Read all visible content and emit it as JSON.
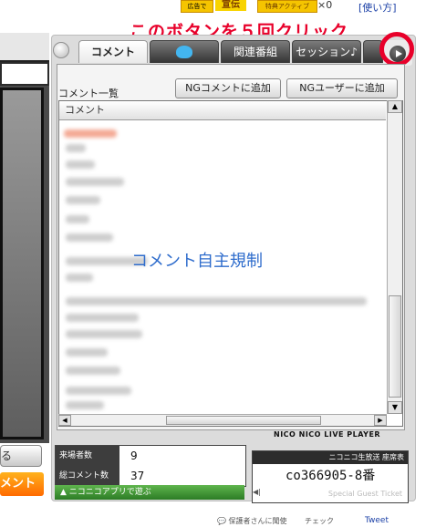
{
  "top": {
    "ad1": "広告で",
    "ad2": "宣伝",
    "ad3": "特典アクティブ",
    "ad4": "×0",
    "usage": "[使い方]"
  },
  "annotation": {
    "instruction": "このボタンを５回クリック",
    "overlay": "コメント自主規制"
  },
  "tabs": [
    {
      "label": "コメント",
      "active": true
    },
    {
      "label": "",
      "icon": "twitter-icon"
    },
    {
      "label": "関連番組"
    },
    {
      "label": "セッション♪"
    },
    {
      "label": ""
    }
  ],
  "comment_panel": {
    "list_title": "コメント一覧",
    "ng_comment_button": "NGコメントに追加",
    "ng_user_button": "NGユーザーに追加",
    "column_header": "コメント"
  },
  "player_label": "NICO NICO LIVE PLAYER",
  "stats": [
    {
      "label": "来場者数",
      "value": "9"
    },
    {
      "label": "総コメント数",
      "value": "37"
    }
  ],
  "app_link": "▲ ニコニコアプリで遊ぶ",
  "ticket": {
    "header": "ニコニコ生放送 座席表",
    "seat_id": "co366905-8番",
    "footer": "Special Guest Ticket"
  },
  "left_controls": {
    "button1": "る",
    "button2": "メント"
  },
  "bottom": {
    "link1": "💬 保護者さんに聞使",
    "link2": "チェック",
    "link3": "Tweet"
  },
  "colors": {
    "accent_red": "#e8002a",
    "overlay_blue": "#2e6ccc",
    "panel_gray": "#dcdcdc"
  }
}
